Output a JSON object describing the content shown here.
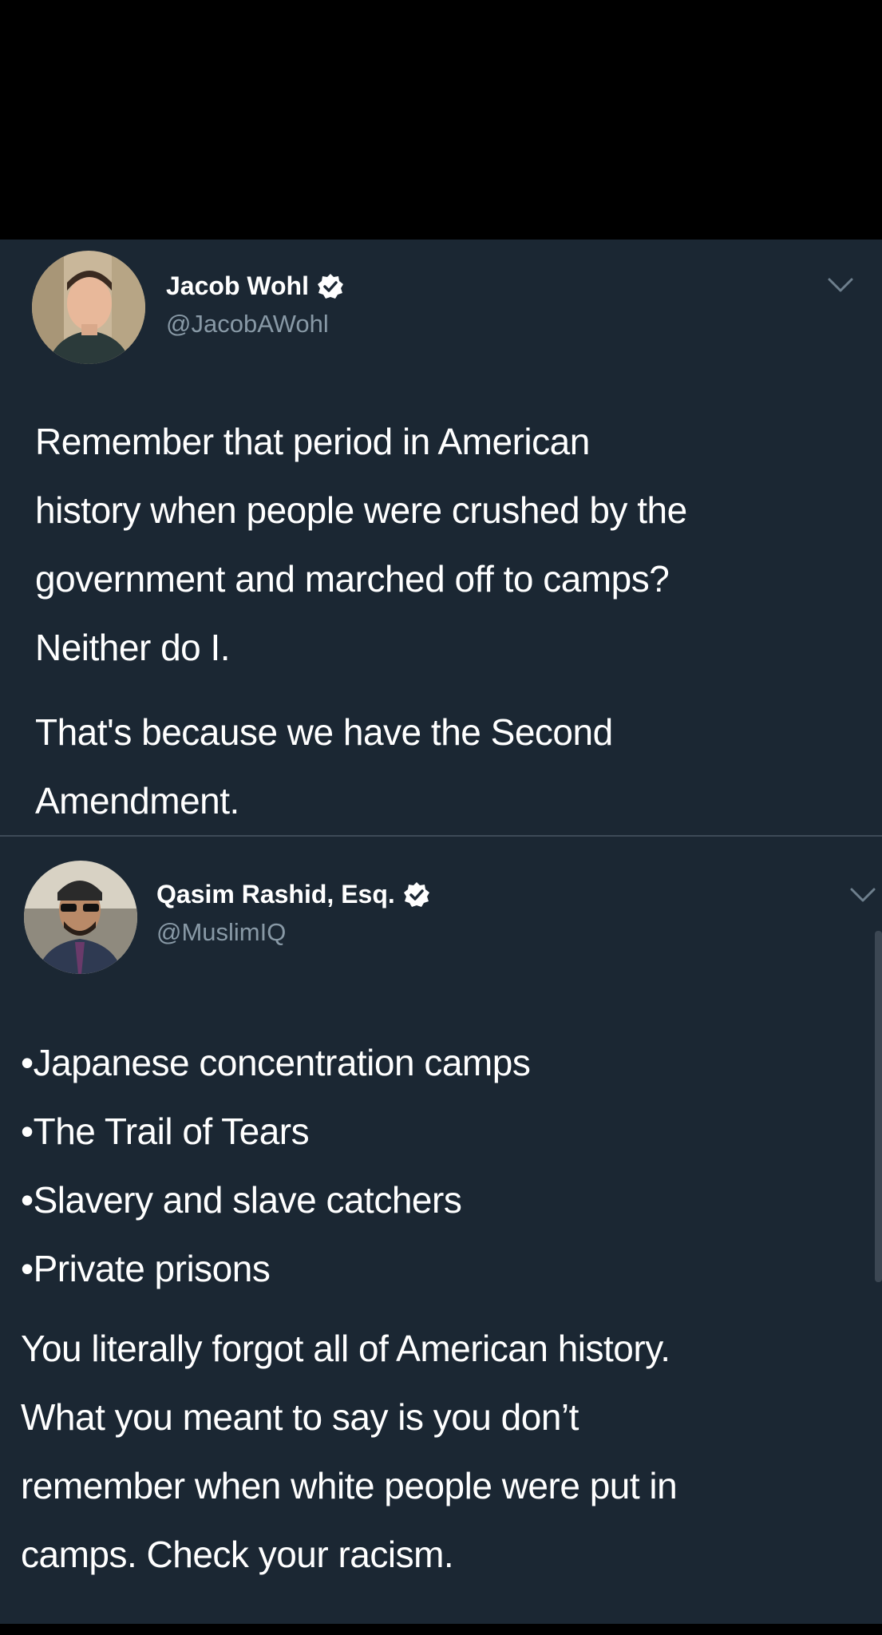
{
  "tweets": [
    {
      "display_name": "Jacob Wohl",
      "handle": "@JacobAWohl",
      "verified": true,
      "body_lines": [
        "Remember that period in American",
        "history when people were crushed by the",
        "government and marched off to camps?",
        "Neither do I."
      ],
      "body_lines_2": [
        "That's because we have the Second",
        "Amendment."
      ]
    },
    {
      "display_name": "Qasim Rashid, Esq.",
      "handle": "@MuslimIQ",
      "verified": true,
      "list_items": [
        "•Japanese concentration camps",
        "•The Trail of Tears",
        "•Slavery and slave catchers",
        "•Private prisons"
      ],
      "body_lines": [
        "You literally forgot all of American history.",
        "What you meant to say is you don’t",
        "remember when white people were put in",
        "camps. Check your racism."
      ]
    }
  ],
  "icons": {
    "verified": "verified-badge-icon",
    "chevron": "chevron-down-icon"
  },
  "colors": {
    "background": "#1b2733",
    "text": "#ffffff",
    "secondary_text": "#8899a6",
    "divider": "#3d4a57",
    "frame": "#000000"
  }
}
